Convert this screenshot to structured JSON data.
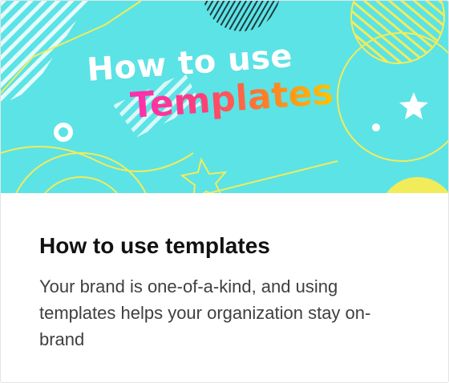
{
  "card": {
    "banner": {
      "line1": "How to use",
      "line2": "Templates"
    },
    "title": "How to use templates",
    "description": "Your brand is one-of-a-kind, and using templates helps your organization stay on-brand"
  },
  "colors": {
    "banner_bg": "#5ce3e6",
    "accent_yellow": "#f2ec5a",
    "title_text": "#111111",
    "body_text": "#3f3f3f"
  }
}
